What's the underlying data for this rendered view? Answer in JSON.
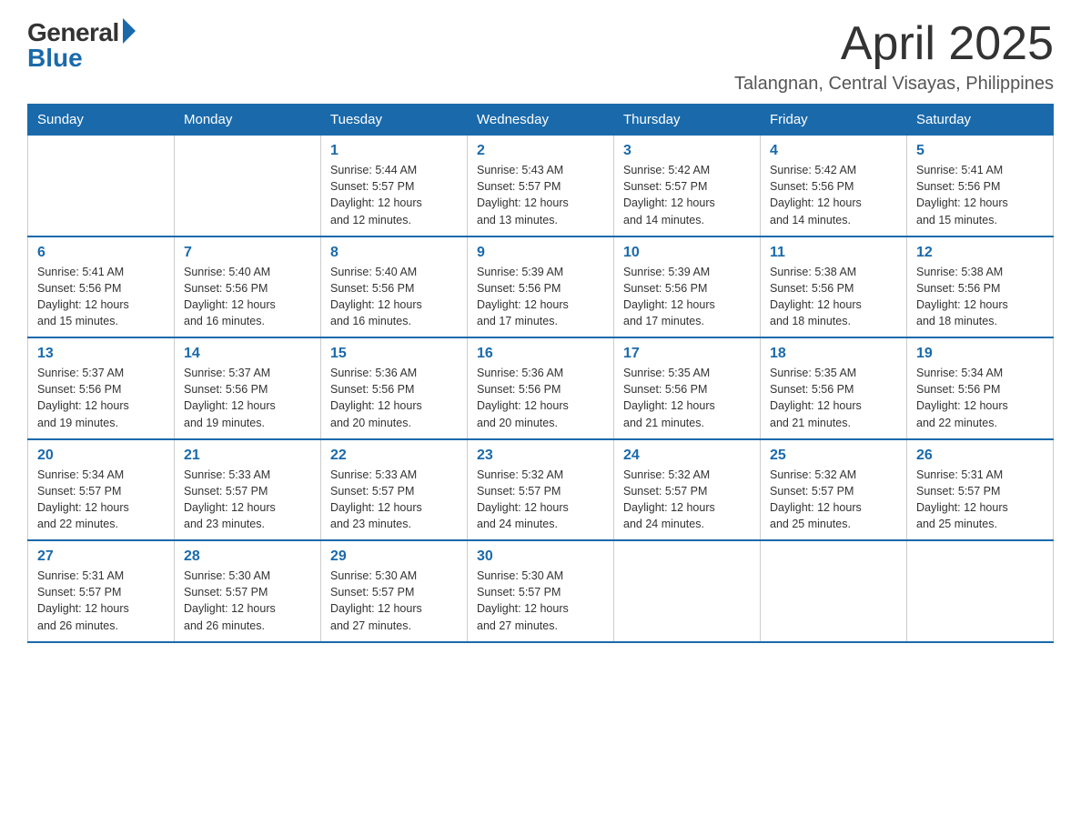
{
  "header": {
    "logo_general": "General",
    "logo_blue": "Blue",
    "month_title": "April 2025",
    "location": "Talangnan, Central Visayas, Philippines"
  },
  "days_of_week": [
    "Sunday",
    "Monday",
    "Tuesday",
    "Wednesday",
    "Thursday",
    "Friday",
    "Saturday"
  ],
  "weeks": [
    [
      {
        "day": "",
        "info": ""
      },
      {
        "day": "",
        "info": ""
      },
      {
        "day": "1",
        "info": "Sunrise: 5:44 AM\nSunset: 5:57 PM\nDaylight: 12 hours\nand 12 minutes."
      },
      {
        "day": "2",
        "info": "Sunrise: 5:43 AM\nSunset: 5:57 PM\nDaylight: 12 hours\nand 13 minutes."
      },
      {
        "day": "3",
        "info": "Sunrise: 5:42 AM\nSunset: 5:57 PM\nDaylight: 12 hours\nand 14 minutes."
      },
      {
        "day": "4",
        "info": "Sunrise: 5:42 AM\nSunset: 5:56 PM\nDaylight: 12 hours\nand 14 minutes."
      },
      {
        "day": "5",
        "info": "Sunrise: 5:41 AM\nSunset: 5:56 PM\nDaylight: 12 hours\nand 15 minutes."
      }
    ],
    [
      {
        "day": "6",
        "info": "Sunrise: 5:41 AM\nSunset: 5:56 PM\nDaylight: 12 hours\nand 15 minutes."
      },
      {
        "day": "7",
        "info": "Sunrise: 5:40 AM\nSunset: 5:56 PM\nDaylight: 12 hours\nand 16 minutes."
      },
      {
        "day": "8",
        "info": "Sunrise: 5:40 AM\nSunset: 5:56 PM\nDaylight: 12 hours\nand 16 minutes."
      },
      {
        "day": "9",
        "info": "Sunrise: 5:39 AM\nSunset: 5:56 PM\nDaylight: 12 hours\nand 17 minutes."
      },
      {
        "day": "10",
        "info": "Sunrise: 5:39 AM\nSunset: 5:56 PM\nDaylight: 12 hours\nand 17 minutes."
      },
      {
        "day": "11",
        "info": "Sunrise: 5:38 AM\nSunset: 5:56 PM\nDaylight: 12 hours\nand 18 minutes."
      },
      {
        "day": "12",
        "info": "Sunrise: 5:38 AM\nSunset: 5:56 PM\nDaylight: 12 hours\nand 18 minutes."
      }
    ],
    [
      {
        "day": "13",
        "info": "Sunrise: 5:37 AM\nSunset: 5:56 PM\nDaylight: 12 hours\nand 19 minutes."
      },
      {
        "day": "14",
        "info": "Sunrise: 5:37 AM\nSunset: 5:56 PM\nDaylight: 12 hours\nand 19 minutes."
      },
      {
        "day": "15",
        "info": "Sunrise: 5:36 AM\nSunset: 5:56 PM\nDaylight: 12 hours\nand 20 minutes."
      },
      {
        "day": "16",
        "info": "Sunrise: 5:36 AM\nSunset: 5:56 PM\nDaylight: 12 hours\nand 20 minutes."
      },
      {
        "day": "17",
        "info": "Sunrise: 5:35 AM\nSunset: 5:56 PM\nDaylight: 12 hours\nand 21 minutes."
      },
      {
        "day": "18",
        "info": "Sunrise: 5:35 AM\nSunset: 5:56 PM\nDaylight: 12 hours\nand 21 minutes."
      },
      {
        "day": "19",
        "info": "Sunrise: 5:34 AM\nSunset: 5:56 PM\nDaylight: 12 hours\nand 22 minutes."
      }
    ],
    [
      {
        "day": "20",
        "info": "Sunrise: 5:34 AM\nSunset: 5:57 PM\nDaylight: 12 hours\nand 22 minutes."
      },
      {
        "day": "21",
        "info": "Sunrise: 5:33 AM\nSunset: 5:57 PM\nDaylight: 12 hours\nand 23 minutes."
      },
      {
        "day": "22",
        "info": "Sunrise: 5:33 AM\nSunset: 5:57 PM\nDaylight: 12 hours\nand 23 minutes."
      },
      {
        "day": "23",
        "info": "Sunrise: 5:32 AM\nSunset: 5:57 PM\nDaylight: 12 hours\nand 24 minutes."
      },
      {
        "day": "24",
        "info": "Sunrise: 5:32 AM\nSunset: 5:57 PM\nDaylight: 12 hours\nand 24 minutes."
      },
      {
        "day": "25",
        "info": "Sunrise: 5:32 AM\nSunset: 5:57 PM\nDaylight: 12 hours\nand 25 minutes."
      },
      {
        "day": "26",
        "info": "Sunrise: 5:31 AM\nSunset: 5:57 PM\nDaylight: 12 hours\nand 25 minutes."
      }
    ],
    [
      {
        "day": "27",
        "info": "Sunrise: 5:31 AM\nSunset: 5:57 PM\nDaylight: 12 hours\nand 26 minutes."
      },
      {
        "day": "28",
        "info": "Sunrise: 5:30 AM\nSunset: 5:57 PM\nDaylight: 12 hours\nand 26 minutes."
      },
      {
        "day": "29",
        "info": "Sunrise: 5:30 AM\nSunset: 5:57 PM\nDaylight: 12 hours\nand 27 minutes."
      },
      {
        "day": "30",
        "info": "Sunrise: 5:30 AM\nSunset: 5:57 PM\nDaylight: 12 hours\nand 27 minutes."
      },
      {
        "day": "",
        "info": ""
      },
      {
        "day": "",
        "info": ""
      },
      {
        "day": "",
        "info": ""
      }
    ]
  ]
}
